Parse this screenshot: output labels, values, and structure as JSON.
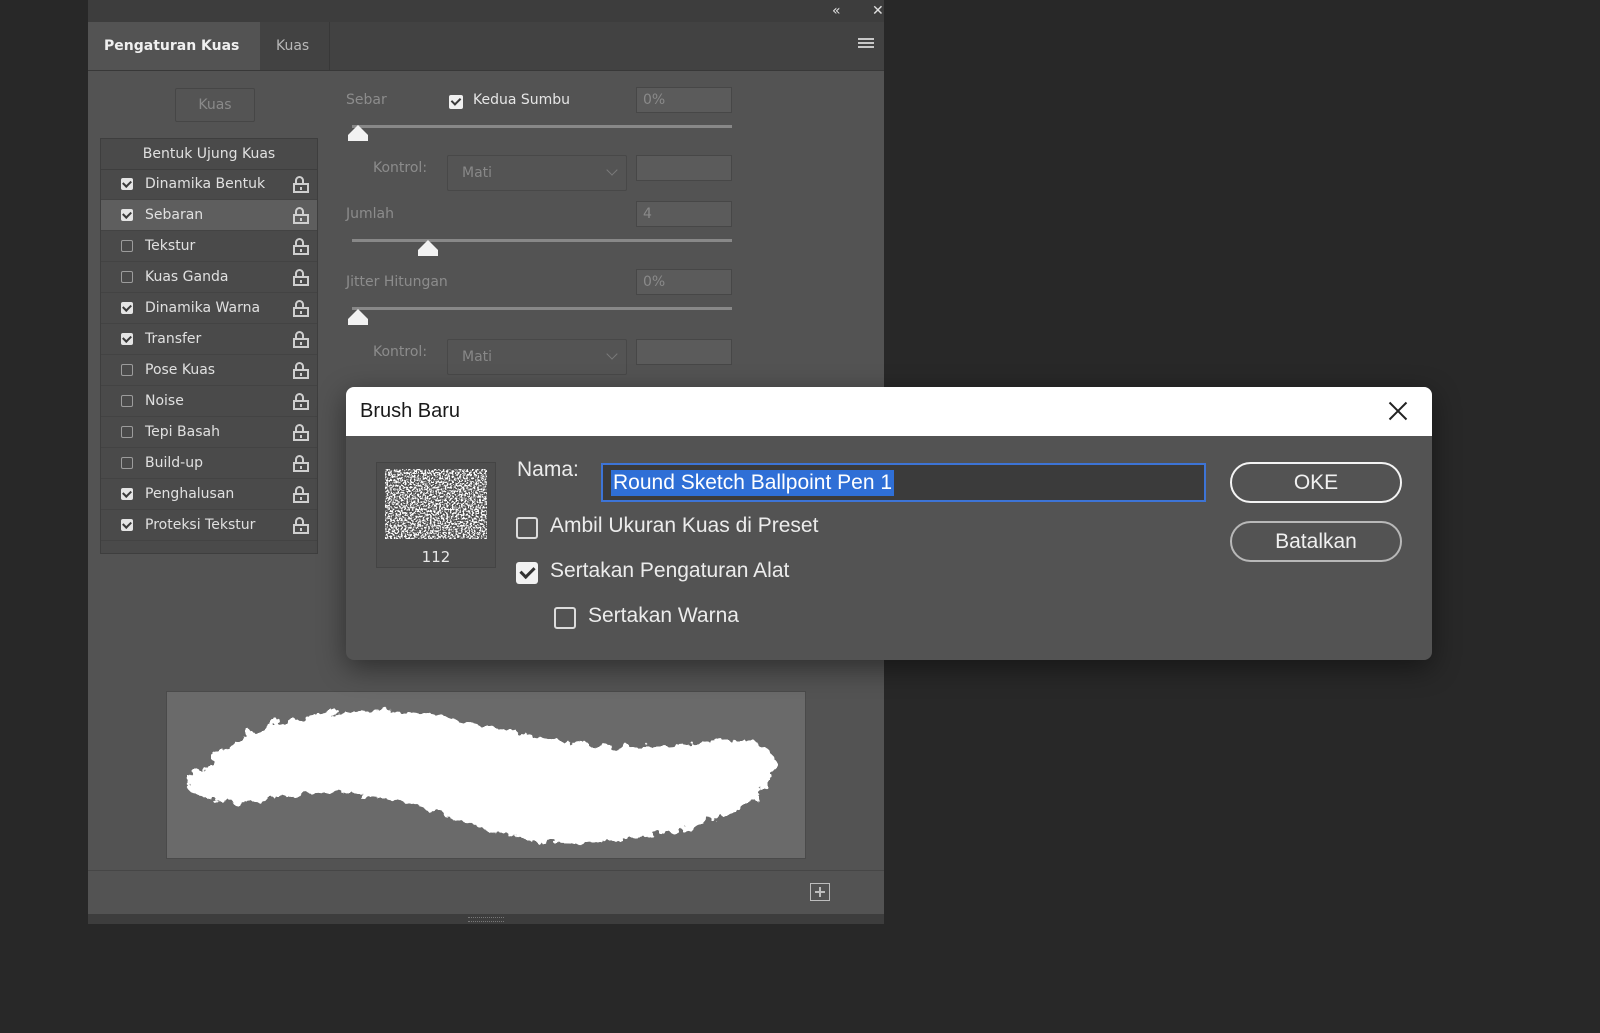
{
  "panel": {
    "tabs": [
      {
        "label": "Pengaturan Kuas",
        "active": true
      },
      {
        "label": "Kuas",
        "active": false
      }
    ],
    "collapse_label": "«",
    "close_label": "✕",
    "kuas_button": "Kuas",
    "list_header": "Bentuk Ujung Kuas",
    "items": [
      {
        "label": "Dinamika Bentuk",
        "checked": true
      },
      {
        "label": "Sebaran",
        "checked": true,
        "selected": true
      },
      {
        "label": "Tekstur",
        "checked": false
      },
      {
        "label": "Kuas Ganda",
        "checked": false
      },
      {
        "label": "Dinamika Warna",
        "checked": true
      },
      {
        "label": "Transfer",
        "checked": true
      },
      {
        "label": "Pose Kuas",
        "checked": false
      },
      {
        "label": "Noise",
        "checked": false
      },
      {
        "label": "Tepi Basah",
        "checked": false
      },
      {
        "label": "Build-up",
        "checked": false
      },
      {
        "label": "Penghalusan",
        "checked": true
      },
      {
        "label": "Proteksi Tekstur",
        "checked": true
      }
    ],
    "scatter": {
      "label": "Sebar",
      "both_axes_label": "Kedua Sumbu",
      "both_axes_checked": true,
      "value": "0%",
      "slider_fraction": 0.0,
      "control_label": "Kontrol:",
      "control_value": "Mati"
    },
    "count": {
      "label": "Jumlah",
      "value": "4",
      "slider_fraction": 0.19
    },
    "count_jitter": {
      "label": "Jitter Hitungan",
      "value": "0%",
      "slider_fraction": 0.0,
      "control_label": "Kontrol:",
      "control_value": "Mati"
    }
  },
  "dialog": {
    "title": "Brush Baru",
    "brush_size": "112",
    "name_label": "Nama:",
    "name_value": "Round Sketch Ballpoint Pen 1",
    "options": [
      {
        "label": "Ambil Ukuran Kuas di Preset",
        "checked": false
      },
      {
        "label": "Sertakan Pengaturan Alat",
        "checked": true
      },
      {
        "label": "Sertakan Warna",
        "checked": false
      }
    ],
    "ok_label": "OKE",
    "cancel_label": "Batalkan"
  },
  "colors": {
    "app_background": "#282828",
    "panel": "#535353",
    "selection": "#2f6fd6"
  }
}
